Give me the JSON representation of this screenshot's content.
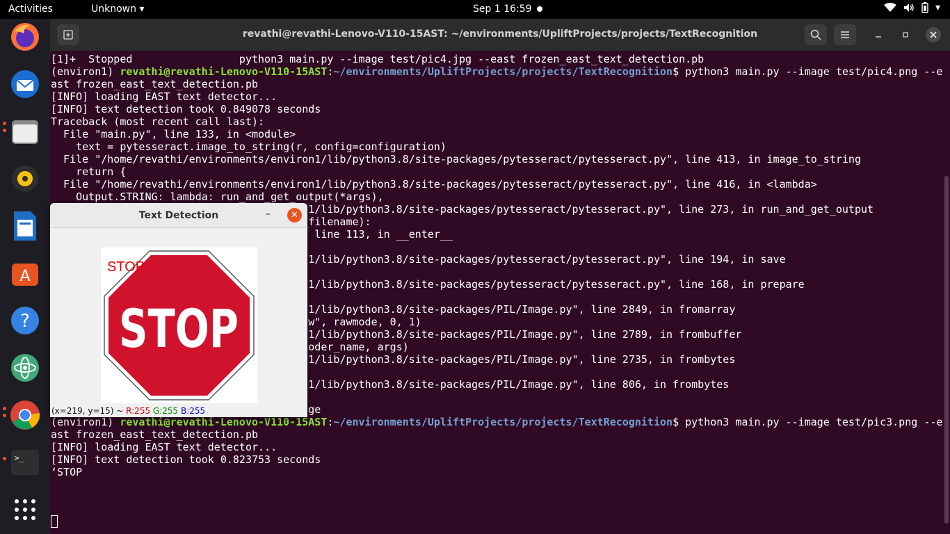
{
  "topbar": {
    "activities": "Activities",
    "app_menu": "Unknown",
    "clock": "Sep 1  16:59"
  },
  "dock": {
    "items": [
      "firefox-icon",
      "thunderbird-icon",
      "files-icon",
      "rhythmbox-icon",
      "writer-icon",
      "software-icon",
      "help-icon",
      "atom-icon",
      "chrome-icon",
      "terminal-icon",
      "app-grid-icon"
    ]
  },
  "terminal": {
    "title": "revathi@revathi-Lenovo-V110-15AST: ~/environments/UpliftProjects/projects/TextRecognition",
    "lines": [
      [
        {
          "t": "[1]+  Stopped                 python3 main.py --image test/pic4.jpg --east frozen_east_text_detection.pb",
          "c": ""
        }
      ],
      [
        {
          "t": "(environ1) ",
          "c": ""
        },
        {
          "t": "revathi@revathi-Lenovo-V110-15AST",
          "c": "green"
        },
        {
          "t": ":",
          "c": ""
        },
        {
          "t": "~/environments/UpliftProjects/projects/TextRecognition",
          "c": "blue"
        },
        {
          "t": "$ python3 main.py --image test/pic4.png --e",
          "c": ""
        }
      ],
      [
        {
          "t": "ast frozen_east_text_detection.pb",
          "c": ""
        }
      ],
      [
        {
          "t": "[INFO] loading EAST text detector...",
          "c": ""
        }
      ],
      [
        {
          "t": "[INFO] text detection took 0.849078 seconds",
          "c": ""
        }
      ],
      [
        {
          "t": "Traceback (most recent call last):",
          "c": ""
        }
      ],
      [
        {
          "t": "  File \"main.py\", line 133, in <module>",
          "c": ""
        }
      ],
      [
        {
          "t": "    text = pytesseract.image_to_string(r, config=configuration)",
          "c": ""
        }
      ],
      [
        {
          "t": "  File \"/home/revathi/environments/environ1/lib/python3.8/site-packages/pytesseract/pytesseract.py\", line 413, in image_to_string",
          "c": ""
        }
      ],
      [
        {
          "t": "    return {",
          "c": ""
        }
      ],
      [
        {
          "t": "  File \"/home/revathi/environments/environ1/lib/python3.8/site-packages/pytesseract/pytesseract.py\", line 416, in <lambda>",
          "c": ""
        }
      ],
      [
        {
          "t": "    Output.STRING: lambda: run_and_get_output(*args),",
          "c": ""
        }
      ],
      [
        {
          "t": "                                        n1/lib/python3.8/site-packages/pytesseract/pytesseract.py\", line 273, in run_and_get_output",
          "c": ""
        }
      ],
      [
        {
          "t": "                                        _filename):",
          "c": ""
        }
      ],
      [
        {
          "t": "                                        , line 113, in __enter__",
          "c": ""
        }
      ],
      [
        {
          "t": "",
          "c": ""
        }
      ],
      [
        {
          "t": "                                        n1/lib/python3.8/site-packages/pytesseract/pytesseract.py\", line 194, in save",
          "c": ""
        }
      ],
      [
        {
          "t": "",
          "c": ""
        }
      ],
      [
        {
          "t": "                                        n1/lib/python3.8/site-packages/pytesseract/pytesseract.py\", line 168, in prepare",
          "c": ""
        }
      ],
      [
        {
          "t": "",
          "c": ""
        }
      ],
      [
        {
          "t": "                                        n1/lib/python3.8/site-packages/PIL/Image.py\", line 2849, in fromarray",
          "c": ""
        }
      ],
      [
        {
          "t": "                                        aw\", rawmode, 0, 1)",
          "c": ""
        }
      ],
      [
        {
          "t": "                                        n1/lib/python3.8/site-packages/PIL/Image.py\", line 2789, in frombuffer",
          "c": ""
        }
      ],
      [
        {
          "t": "                                        coder_name, args)",
          "c": ""
        }
      ],
      [
        {
          "t": "                                        n1/lib/python3.8/site-packages/PIL/Image.py\", line 2735, in frombytes",
          "c": ""
        }
      ],
      [
        {
          "t": "                                        )",
          "c": ""
        }
      ],
      [
        {
          "t": "                                        n1/lib/python3.8/site-packages/PIL/Image.py\", line 806, in frombytes",
          "c": ""
        }
      ],
      [
        {
          "t": "",
          "c": ""
        }
      ],
      [
        {
          "t": "                                        age",
          "c": ""
        }
      ],
      [
        {
          "t": "(environ1) ",
          "c": ""
        },
        {
          "t": "revathi@revathi-Lenovo-V110-15AST",
          "c": "green"
        },
        {
          "t": ":",
          "c": ""
        },
        {
          "t": "~/environments/UpliftProjects/projects/TextRecognition",
          "c": "blue"
        },
        {
          "t": "$ python3 main.py --image test/pic3.png --e",
          "c": ""
        }
      ],
      [
        {
          "t": "ast frozen_east_text_detection.pb",
          "c": ""
        }
      ],
      [
        {
          "t": "[INFO] loading EAST text detector...",
          "c": ""
        }
      ],
      [
        {
          "t": "[INFO] text detection took 0.823753 seconds",
          "c": ""
        }
      ],
      [
        {
          "t": "‘STOP",
          "c": ""
        }
      ]
    ]
  },
  "dialog": {
    "title": "Text Detection",
    "minimize": "–",
    "close": "✕",
    "sign_text": "STOP",
    "overlay_text": "STOP",
    "status_coords": "(x=219, y=15) ~ ",
    "status_r": "R:255",
    "status_g": "G:255",
    "status_b": "B:255"
  },
  "colors": {
    "terminal_bg": "#300a24",
    "prompt_user": "#8ae234",
    "prompt_path": "#729fcf",
    "sign_red": "#d0122d",
    "accent": "#e95420"
  }
}
